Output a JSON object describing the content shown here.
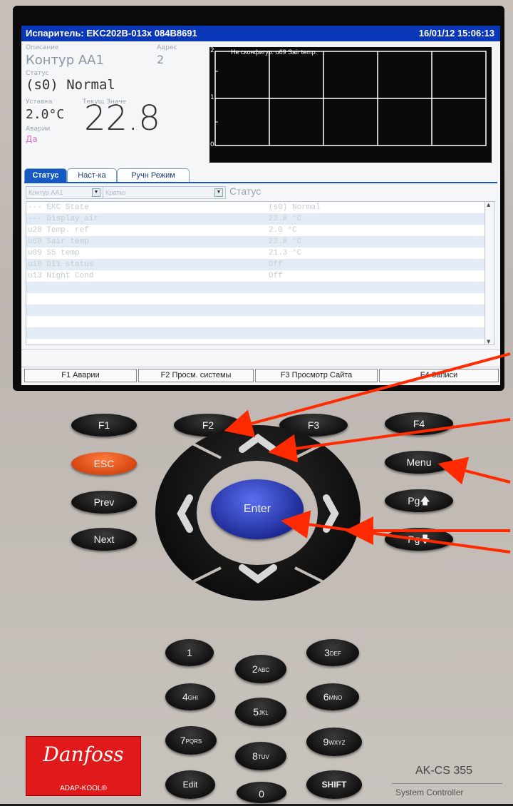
{
  "screen": {
    "title": "Испаритель: EKC202B-013x 084B8691",
    "datetime": "16/01/12 15:06:13",
    "labels": {
      "description": "Описание",
      "address": "Адрес",
      "status": "Статус",
      "setpoint": "Уставка",
      "current": "Текущ Значе",
      "alarms": "Аварии"
    },
    "values": {
      "description": "Контур АА1",
      "address": "2",
      "status": "(s0) Normal",
      "setpoint": "2.0°C",
      "current": "22.8",
      "alarms": "Да"
    },
    "graph": {
      "message": "Не сконфигур: u69 Sair temp.",
      "y_ticks": [
        "2",
        "1",
        "0"
      ]
    },
    "tabs": [
      "Статус",
      "Наст-ка",
      "Ручн Режим"
    ],
    "filter": {
      "circuit": "Контур АА1",
      "mode": "Кратко",
      "view": "Статус"
    },
    "rows": [
      {
        "name": "--- EKC State",
        "value": "(s0) Normal"
      },
      {
        "name": "--- Display air",
        "value": "22.8 °C"
      },
      {
        "name": "u28 Temp. ref",
        "value": "2.0 °C"
      },
      {
        "name": "u69 Sair temp",
        "value": "22.8 °C"
      },
      {
        "name": "u09 S5 temp",
        "value": "21.3 °C"
      },
      {
        "name": "u10 DI1 status",
        "value": "Off"
      },
      {
        "name": "u13 Night Cond",
        "value": "Off"
      }
    ],
    "fkeys": [
      "F1 Аварии",
      "F2 Просм. системы",
      "F3 Просмотр Сайта",
      "F4 Записи"
    ]
  },
  "keypad": {
    "f1": "F1",
    "f2": "F2",
    "f3": "F3",
    "f4": "F4",
    "esc": "ESC",
    "prev": "Prev",
    "next": "Next",
    "menu": "Menu",
    "pgup": "Pg",
    "pgdn": "Pg",
    "enter": "Enter",
    "num": [
      {
        "d": "1",
        "l": ""
      },
      {
        "d": "2",
        "l": "ABC"
      },
      {
        "d": "3",
        "l": "DEF"
      },
      {
        "d": "4",
        "l": "GHI"
      },
      {
        "d": "5",
        "l": "JKL"
      },
      {
        "d": "6",
        "l": "MNO"
      },
      {
        "d": "7",
        "l": "PQRS"
      },
      {
        "d": "8",
        "l": "TUV"
      },
      {
        "d": "9",
        "l": "WXYZ"
      },
      {
        "d": "0",
        "l": ""
      }
    ],
    "edit": "Edit",
    "shift": "SHIFT"
  },
  "brand": {
    "logo": "Danfoss",
    "sub": "ADAP-KOOL®",
    "model": "AK-CS 355",
    "model_sub": "System Controller"
  },
  "colors": {
    "annotation": "#ff2a00",
    "title_bar": "#0a37b8",
    "enter": "#1a2690",
    "esc": "#d3440f"
  }
}
